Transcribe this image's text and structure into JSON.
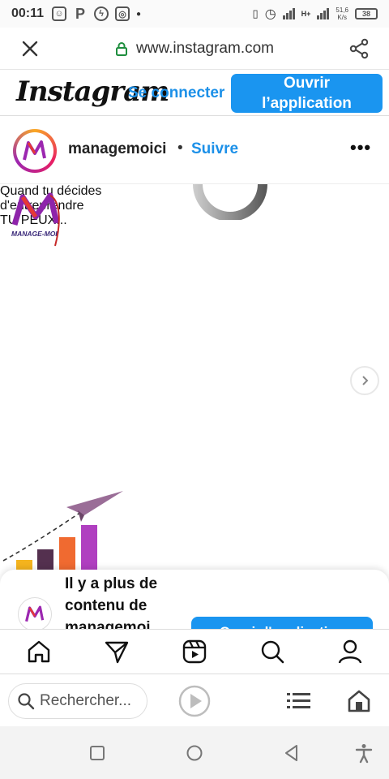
{
  "status_bar": {
    "time": "00:11",
    "app_icons": [
      "contacts-icon",
      "pinterest-icon",
      "messenger-icon",
      "instagram-icon"
    ],
    "speed_value": "51,6",
    "speed_unit": "K/s",
    "battery": "38",
    "network": "H+"
  },
  "browser": {
    "url": "www.instagram.com",
    "search_placeholder": "Rechercher..."
  },
  "instagram_header": {
    "logo": "Instagram",
    "login_link": "Se connecter",
    "open_app_line1": "Ouvrir",
    "open_app_line2": "l’application"
  },
  "post": {
    "username": "managemoici",
    "separator": "•",
    "follow": "Suivre",
    "more": "•••",
    "brand_text": "MANAGE-MOI",
    "headline_line1": "Quand tu décides",
    "headline_line2": "d'entreprendre",
    "headline_line3": "TU PEUX..."
  },
  "bottom_sheet": {
    "text": "Il y a plus de contenu de managemoi",
    "button": "Ouvrir l'application"
  },
  "colors": {
    "accent_blue": "#1a95f0",
    "link_blue": "#1c90e8",
    "bar_yellow": "#f5b41e",
    "bar_dark": "#54304f",
    "bar_orange": "#f06a30",
    "bar_purple": "#b03fc0",
    "plane_purple": "#9a6d97"
  }
}
